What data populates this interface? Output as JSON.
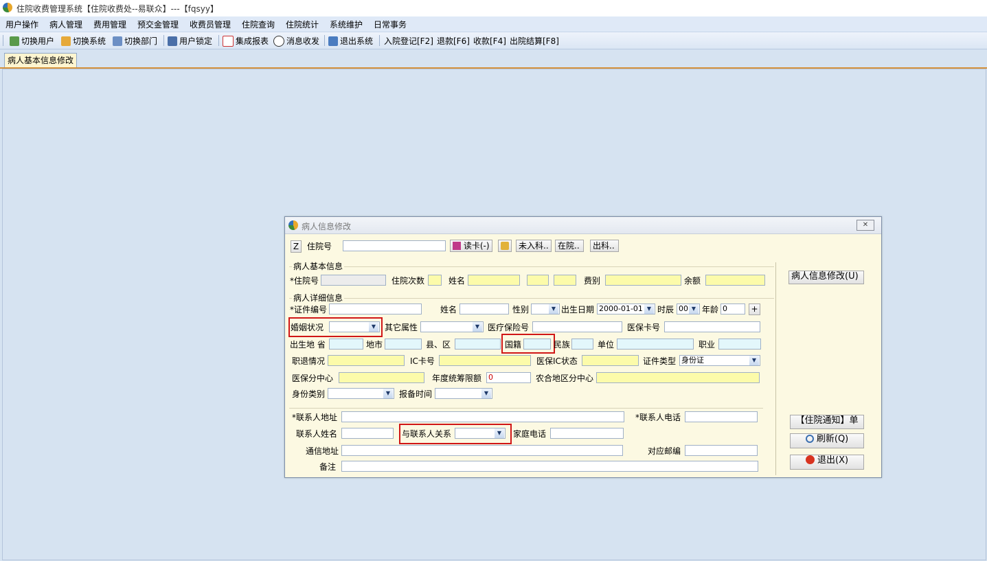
{
  "window": {
    "title": "住院收费管理系统【住院收费处--易联众】---【fqsyy】"
  },
  "menu": [
    "用户操作",
    "病人管理",
    "费用管理",
    "预交金管理",
    "收费员管理",
    "住院查询",
    "住院统计",
    "系统维护",
    "日常事务"
  ],
  "toolbar": {
    "switch_user": "切换用户",
    "switch_system": "切换系统",
    "switch_dept": "切换部门",
    "lock_user": "用户锁定",
    "report": "集成报表",
    "message": "消息收发",
    "exit": "退出系统",
    "admit": "入院登记[F2]",
    "refund": "退款[F6]",
    "collect": "收款[F4]",
    "discharge": "出院结算[F8]"
  },
  "tab": {
    "label": "病人基本信息修改"
  },
  "dialog": {
    "title": "病人信息修改",
    "close": "✕",
    "top": {
      "z_btn": "Z",
      "inpatient_no_label": "住院号",
      "read_card": "读卡(-)",
      "not_in_dept": "未入科..",
      "in_hospital": "在院..",
      "out_dept": "出科.."
    },
    "basic": {
      "group": "病人基本信息",
      "inpatient_no": "*住院号",
      "times": "住院次数",
      "name": "姓名",
      "fee_type": "费别",
      "balance": "余额"
    },
    "detail": {
      "group": "病人详细信息",
      "id_no": "*证件编号",
      "name": "姓名",
      "gender": "性别",
      "birth": "出生日期",
      "birth_value": "2000-01-01",
      "hour": "时辰",
      "hour_value": "00",
      "age": "年龄",
      "age_value": "0",
      "plus": "+",
      "marital": "婚姻状况",
      "other_attr": "其它属性",
      "ins_no": "医疗保险号",
      "ins_card": "医保卡号",
      "birthplace": "出生地 省",
      "city": "地市",
      "county": "县、区",
      "nationality": "国籍",
      "ethnic": "民族",
      "unit": "单位",
      "job": "职业",
      "retire": "职退情况",
      "ic_card": "IC卡号",
      "ic_status": "医保IC状态",
      "id_type": "证件类型",
      "id_type_value": "身份证",
      "ins_center": "医保分中心",
      "annual_limit": "年度统筹限额",
      "annual_limit_value": "0",
      "rural_center": "农合地区分中心",
      "identity": "身份类别",
      "report_time": "报备时间"
    },
    "contact": {
      "address": "*联系人地址",
      "phone": "*联系人电话",
      "name": "联系人姓名",
      "relation": "与联系人关系",
      "home_phone": "家庭电话",
      "mail_addr": "通信地址",
      "postcode": "对应邮编",
      "remark": "备注"
    },
    "side": {
      "modify": "病人信息修改(U)",
      "notice": "【住院通知】单",
      "refresh": "刷新(Q)",
      "exit": "退出(X)"
    }
  }
}
